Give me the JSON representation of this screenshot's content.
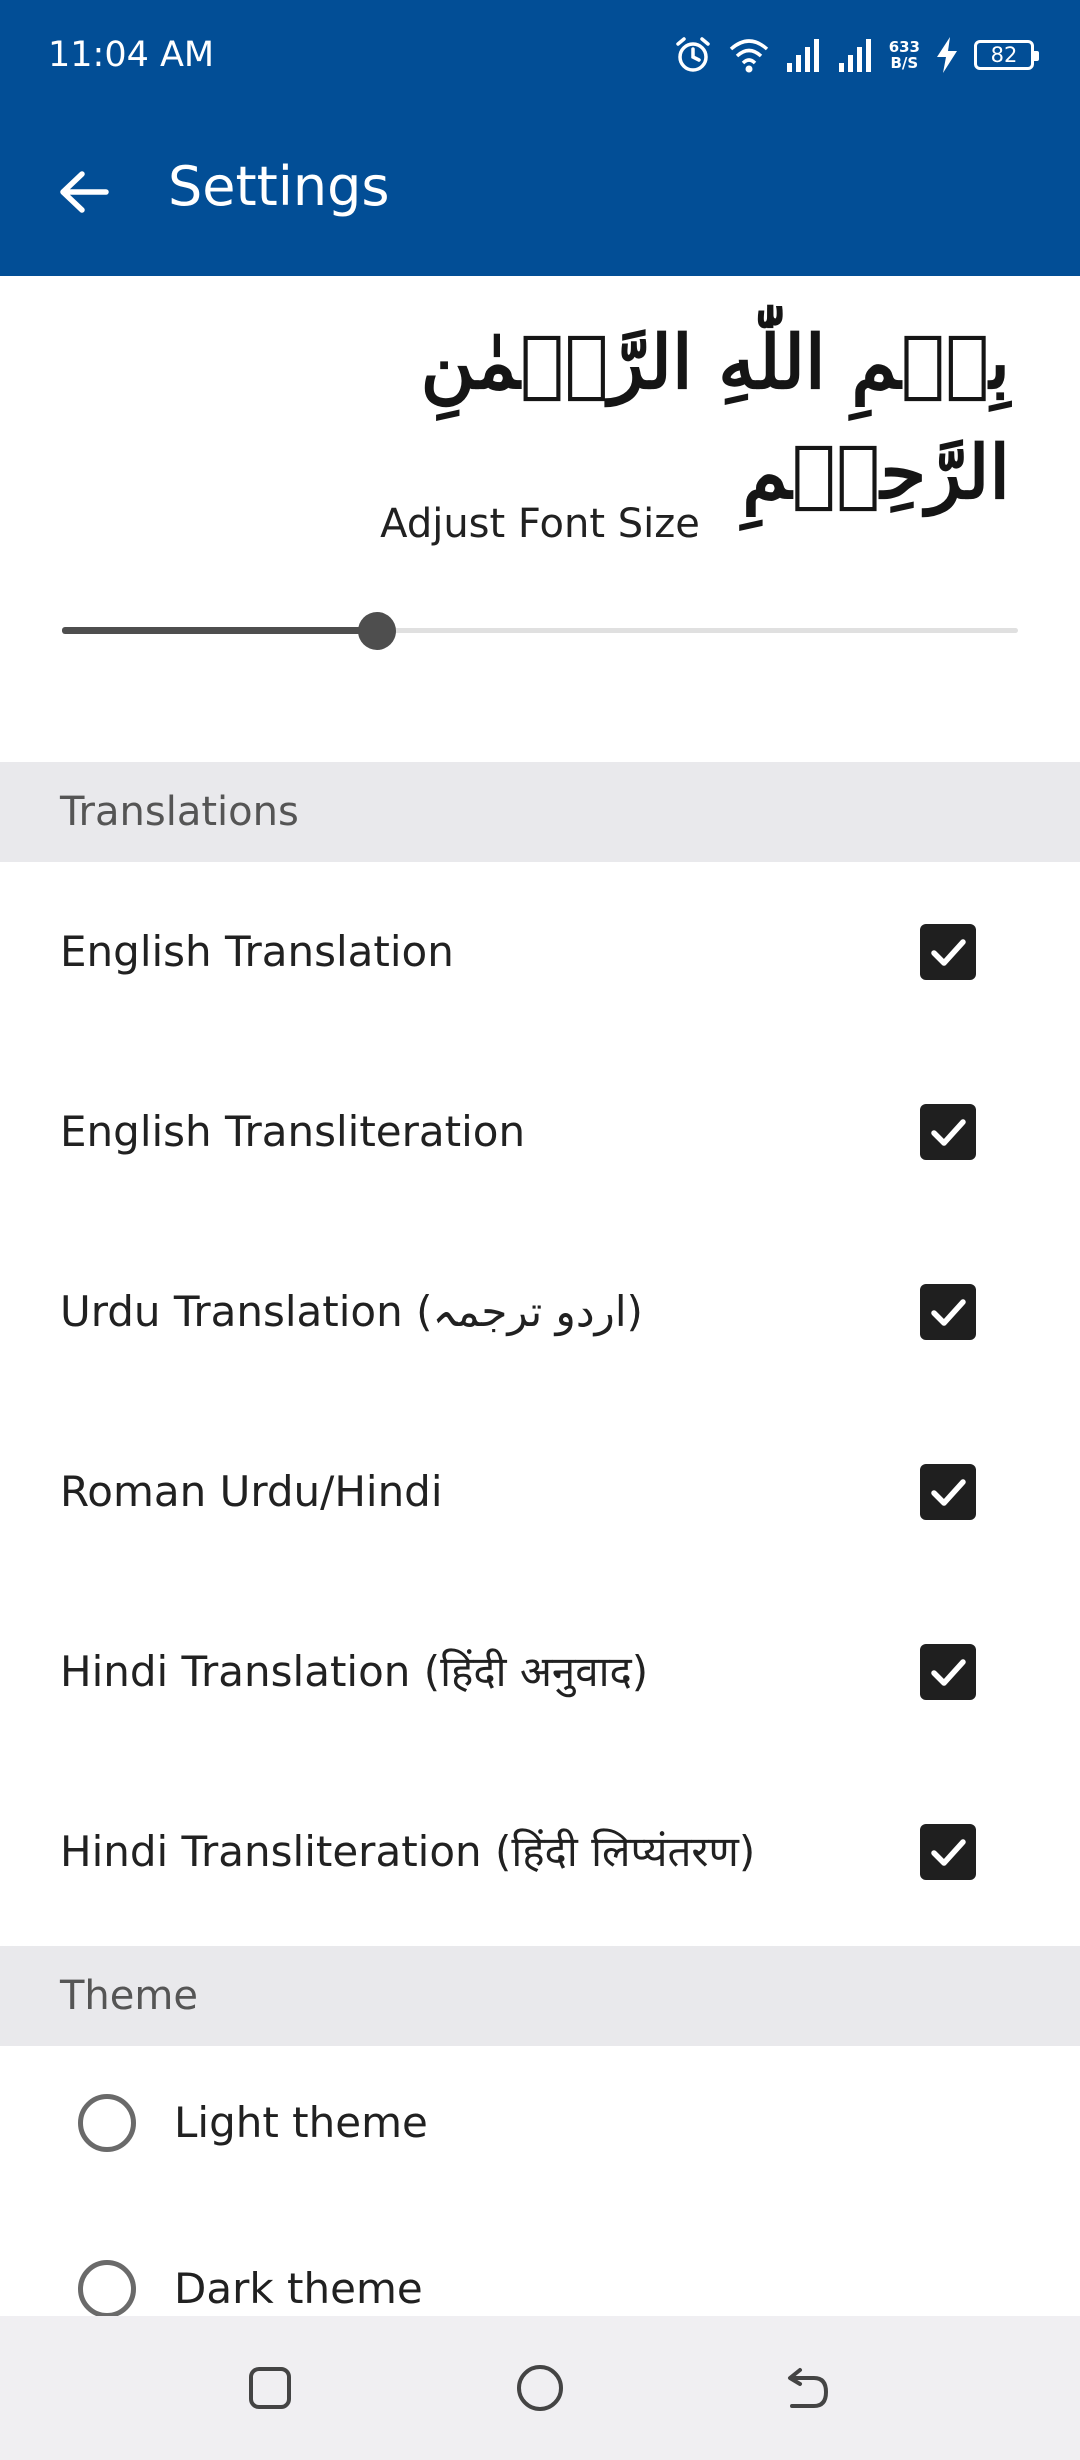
{
  "status_bar": {
    "time": "11:04 AM",
    "net_speed_value": "633",
    "net_speed_unit": "B/S",
    "battery": "82",
    "icons": [
      "alarm-icon",
      "wifi-icon",
      "signal-icon",
      "signal-icon",
      "charging-icon",
      "battery-icon"
    ]
  },
  "app_bar": {
    "title": "Settings",
    "back_icon": "arrow-back-icon",
    "color": "#024e96"
  },
  "header": {
    "bismillah": "بِسۡمِ اللّٰهِ الرَّحۡمٰنِ الرَّحِيۡمِ",
    "font_size_label": "Adjust Font Size",
    "font_size_slider_level": 0.33
  },
  "translations": {
    "title": "Translations",
    "items": [
      {
        "label": "English Translation",
        "checked": true
      },
      {
        "label": "English Transliteration",
        "checked": true
      },
      {
        "label": "Urdu Translation (اردو ترجمہ)",
        "checked": true
      },
      {
        "label": "Roman Urdu/Hindi",
        "checked": true
      },
      {
        "label": "Hindi Translation (हिंदी अनुवाद)",
        "checked": true
      },
      {
        "label": "Hindi Transliteration (हिंदी  लिप्यंतरण)",
        "checked": true
      }
    ]
  },
  "theme": {
    "title": "Theme",
    "options": [
      {
        "label": "Light theme",
        "selected": false
      },
      {
        "label": "Dark theme",
        "selected": false
      }
    ]
  },
  "nav_bar": {
    "buttons": [
      "recents-icon",
      "home-icon",
      "back-icon"
    ]
  }
}
